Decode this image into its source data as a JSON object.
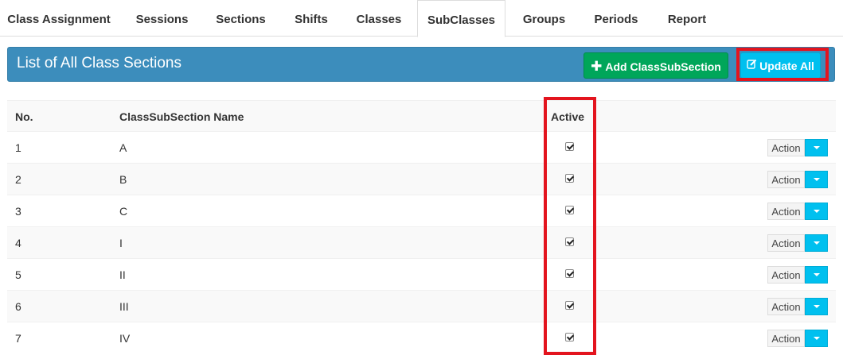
{
  "tabs": [
    {
      "label": "Class Assignment"
    },
    {
      "label": "Sessions"
    },
    {
      "label": "Sections"
    },
    {
      "label": "Shifts"
    },
    {
      "label": "Classes"
    },
    {
      "label": "SubClasses"
    },
    {
      "label": "Groups"
    },
    {
      "label": "Periods"
    },
    {
      "label": "Report"
    }
  ],
  "active_tab": "SubClasses",
  "header": {
    "title": "List of All Class Sections",
    "add_button_label": "Add ClassSubSection",
    "update_button_label": "Update All"
  },
  "table": {
    "columns": {
      "no": "No.",
      "name": "ClassSubSection Name",
      "active": "Active"
    },
    "rows": [
      {
        "no": "1",
        "name": "A",
        "active": true,
        "action": "Action"
      },
      {
        "no": "2",
        "name": "B",
        "active": true,
        "action": "Action"
      },
      {
        "no": "3",
        "name": "C",
        "active": true,
        "action": "Action"
      },
      {
        "no": "4",
        "name": "I",
        "active": true,
        "action": "Action"
      },
      {
        "no": "5",
        "name": "II",
        "active": true,
        "action": "Action"
      },
      {
        "no": "6",
        "name": "III",
        "active": true,
        "action": "Action"
      },
      {
        "no": "7",
        "name": "IV",
        "active": true,
        "action": "Action"
      }
    ]
  },
  "colors": {
    "header_bg": "#3c8dbc",
    "add_button": "#00a65a",
    "update_button": "#00c0ef",
    "highlight": "#e3141e"
  }
}
